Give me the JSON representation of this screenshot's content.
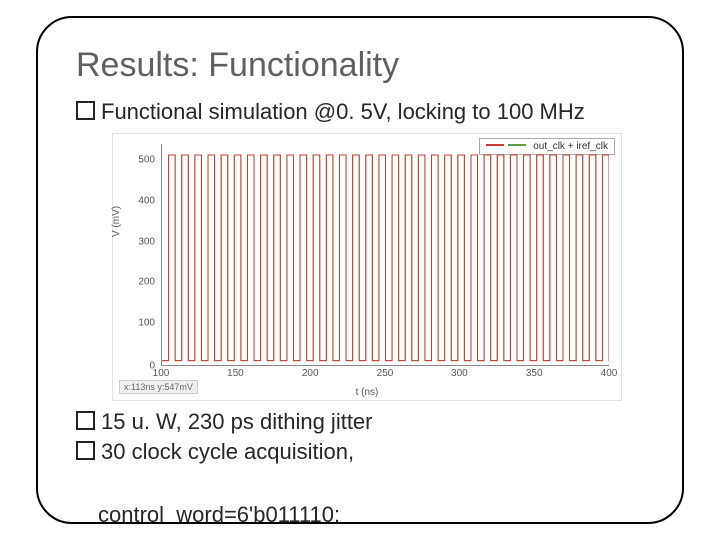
{
  "title": "Results: Functionality",
  "bullets": {
    "b1": "Functional simulation @0. 5V, locking to 100 MHz",
    "b2": "15 u. W, 230 ps dithing jitter",
    "b3": "30 clock cycle acquisition,",
    "b4": "control_word=6'b011110:"
  },
  "chart_data": {
    "type": "line",
    "title": "",
    "xlabel": "t (ns)",
    "ylabel": "V (mV)",
    "xlim": [
      100,
      440
    ],
    "ylim": [
      -50,
      550
    ],
    "y_ticks": [
      0,
      100,
      200,
      300,
      400,
      500
    ],
    "x_ticks": [
      100,
      150,
      200,
      250,
      300,
      350,
      400
    ],
    "legend": [
      "out_clk",
      "iref_clk"
    ],
    "legend_joined": "out_clk + iref_clk",
    "colors": {
      "out_clk": "#cc3b2e",
      "iref_clk": "#5a9e3d"
    },
    "note": "Dense square-wave clock signals ~100 MHz (period ≈10 ns) toggling between 0 mV and 500 mV; two phase-aligned clocks (red out_clk, green iref_clk).",
    "corner_readout": "x:113ns   y:547mV"
  }
}
